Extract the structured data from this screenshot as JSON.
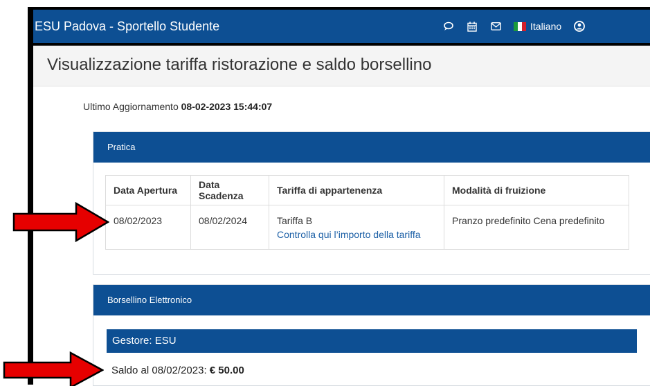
{
  "navbar": {
    "brand": "ESU Padova - Sportello Studente",
    "language": "Italiano",
    "icons": [
      "chat-icon",
      "calendar-icon",
      "mail-icon",
      "flag-icon",
      "user-icon"
    ],
    "accent": "#0d4f93"
  },
  "page": {
    "title": "Visualizzazione tariffa ristorazione e saldo borsellino",
    "update_label": "Ultimo Aggiornamento",
    "update_value": "08-02-2023 15:44:07"
  },
  "pratica": {
    "title": "Pratica",
    "headers": [
      "Data Apertura",
      "Data Scadenza",
      "Tariffa di appartenenza",
      "Modalità di fruizione"
    ],
    "row": {
      "apertura": "08/02/2023",
      "scadenza": "08/02/2024",
      "tariffa": "Tariffa B",
      "tariffa_link": "Controlla qui l’importo della tariffa",
      "modalita": "Pranzo predefinito Cena predefinito"
    }
  },
  "borsellino": {
    "title": "Borsellino Elettronico",
    "gestore": "Gestore: ESU",
    "saldo_label": "Saldo al 08/02/2023:",
    "saldo_value": "€ 50.00"
  },
  "annotation_color": "#e60000"
}
